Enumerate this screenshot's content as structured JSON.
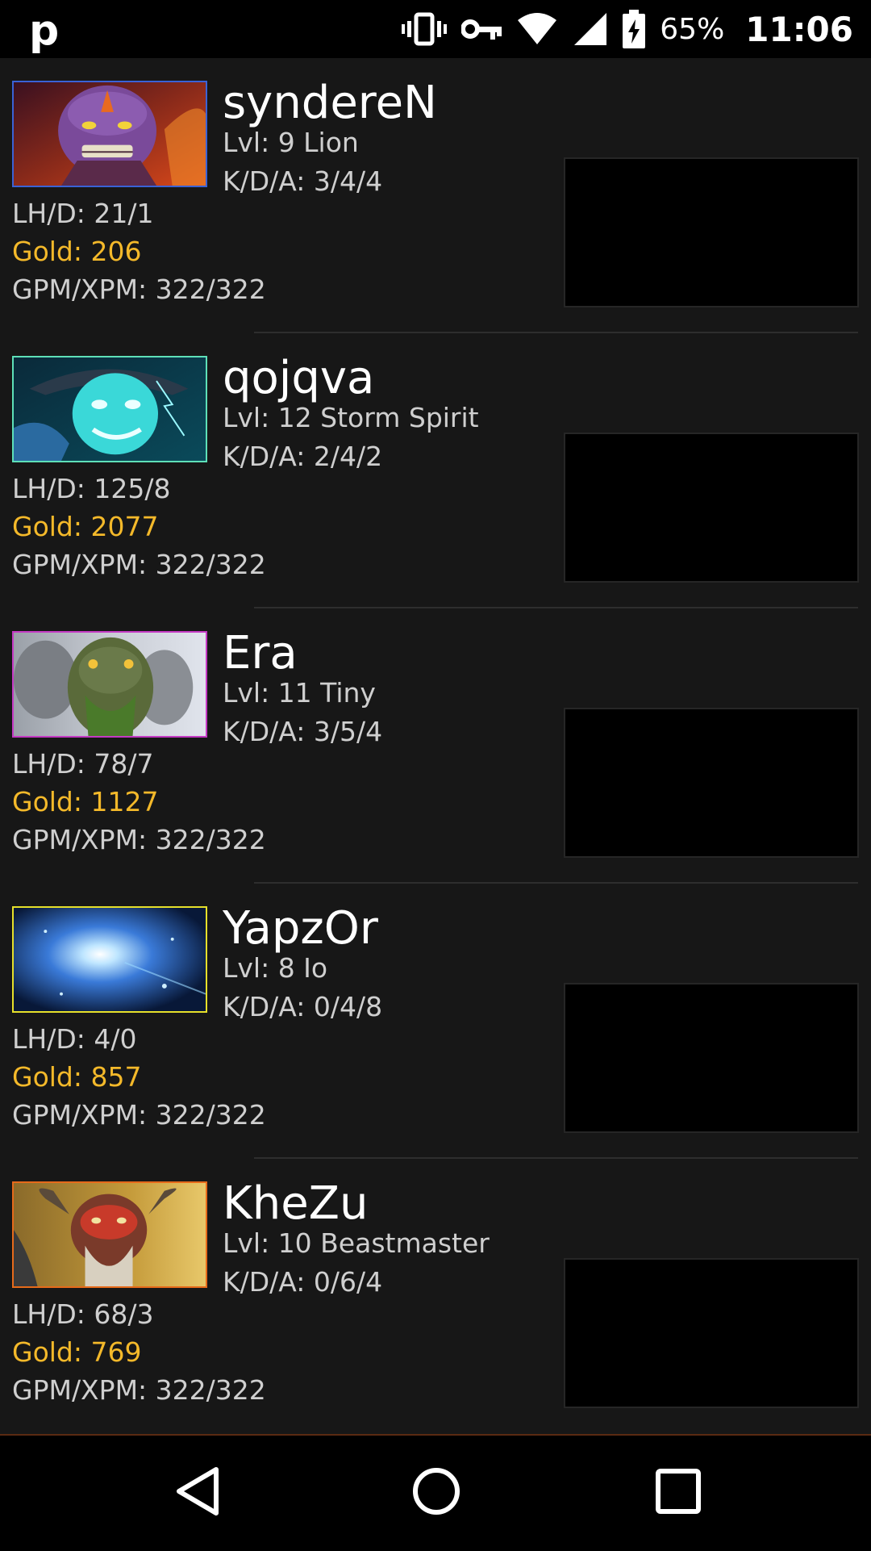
{
  "status_bar": {
    "app_letter": "p",
    "battery_percent": "65%",
    "time": "11:06",
    "icons": [
      "vibrate-icon",
      "vpn-key-icon",
      "wifi-icon",
      "cell-signal-icon",
      "battery-charging-icon"
    ]
  },
  "players": [
    {
      "name": "syndereN",
      "level": "Lvl: 9 Lion",
      "kda": "K/D/A: 3/4/4",
      "lhd": "LH/D: 21/1",
      "gold": "Gold: 206",
      "gpm_xpm": "GPM/XPM: 322/322",
      "border_color": "#3a62d6",
      "hero_icon": "lion-hero-portrait"
    },
    {
      "name": "qojqva",
      "level": "Lvl: 12 Storm Spirit",
      "kda": "K/D/A: 2/4/2",
      "lhd": "LH/D: 125/8",
      "gold": "Gold: 2077",
      "gpm_xpm": "GPM/XPM: 322/322",
      "border_color": "#5ee0b8",
      "hero_icon": "storm-spirit-hero-portrait"
    },
    {
      "name": "Era",
      "level": "Lvl: 11 Tiny",
      "kda": "K/D/A: 3/5/4",
      "lhd": "LH/D: 78/7",
      "gold": "Gold: 1127",
      "gpm_xpm": "GPM/XPM: 322/322",
      "border_color": "#c43ac4",
      "hero_icon": "tiny-hero-portrait"
    },
    {
      "name": "YapzOr",
      "level": "Lvl: 8 Io",
      "kda": "K/D/A: 0/4/8",
      "lhd": "LH/D: 4/0",
      "gold": "Gold: 857",
      "gpm_xpm": "GPM/XPM: 322/322",
      "border_color": "#e6e02a",
      "hero_icon": "io-hero-portrait"
    },
    {
      "name": "KheZu",
      "level": "Lvl: 10 Beastmaster",
      "kda": "K/D/A: 0/6/4",
      "lhd": "LH/D: 68/3",
      "gold": "Gold: 769",
      "gpm_xpm": "GPM/XPM: 322/322",
      "border_color": "#e66a1a",
      "hero_icon": "beastmaster-hero-portrait"
    }
  ],
  "colors": {
    "background": "#171717",
    "gold_text": "#f4b92a",
    "stat_text": "#cfcfcf"
  },
  "nav_bar": {
    "icons": [
      "back-icon",
      "home-icon",
      "recents-icon"
    ]
  }
}
